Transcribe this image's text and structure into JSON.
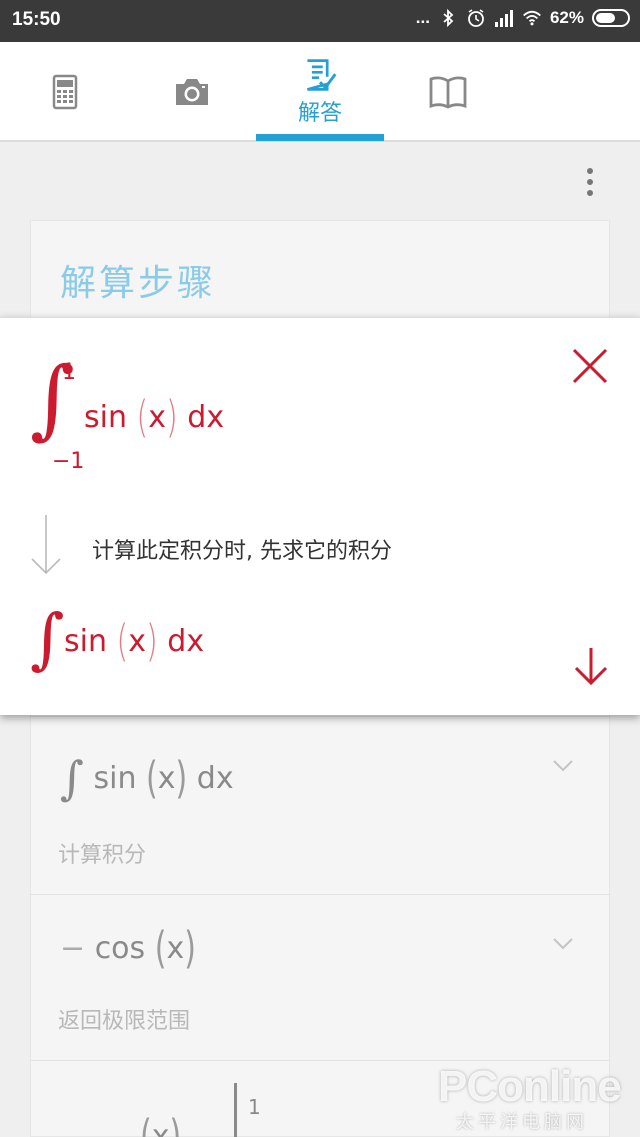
{
  "status_bar": {
    "time": "15:50",
    "dots": "...",
    "battery": "62%",
    "battery_level": 0.62,
    "icons": [
      "bluetooth-icon",
      "alarm-icon",
      "signal-icon",
      "wifi-icon",
      "battery-icon"
    ]
  },
  "tabs": [
    {
      "icon": "calculator-icon",
      "label": ""
    },
    {
      "icon": "camera-icon",
      "label": ""
    },
    {
      "icon": "answer-icon",
      "label": "解答",
      "active": true
    },
    {
      "icon": "book-icon",
      "label": ""
    }
  ],
  "colors": {
    "accent": "#23a0d6",
    "math_red": "#cc1a2e",
    "title_blue": "#8ccbe8"
  },
  "steps_title": "解算步骤",
  "popup": {
    "integral_sign": "∫",
    "upper_limit": "1",
    "lower_limit": "−1",
    "function": "sin",
    "variable": "x",
    "differential": "dx",
    "step_description": "计算此定积分时, 先求它的积分",
    "result_sign": "∫",
    "result_function": "sin",
    "result_variable": "x",
    "result_differential": "dx"
  },
  "steps": [
    {
      "integral": "∫",
      "function": "sin",
      "variable": "x",
      "differential": "dx",
      "description": "计算积分"
    },
    {
      "prefix": "−",
      "function": "cos",
      "variable": "x",
      "description": "返回极限范围"
    },
    {
      "variable": "x",
      "upper_limit": "1"
    }
  ],
  "watermark": {
    "brand": "PConline",
    "sub": "太平洋电脑网"
  }
}
